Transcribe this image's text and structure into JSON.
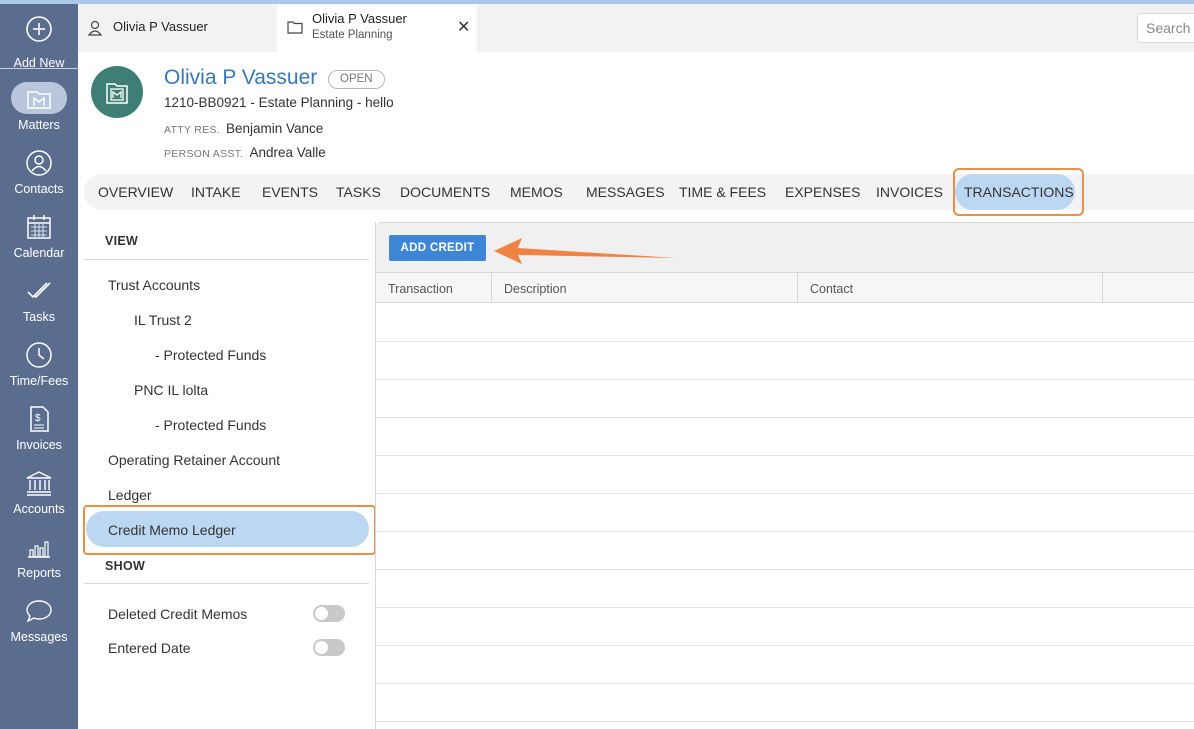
{
  "nav": {
    "add_new": "Add New",
    "items": [
      {
        "label": "Matters",
        "icon": "matters-icon"
      },
      {
        "label": "Contacts",
        "icon": "contacts-icon"
      },
      {
        "label": "Calendar",
        "icon": "calendar-icon"
      },
      {
        "label": "Tasks",
        "icon": "tasks-icon"
      },
      {
        "label": "Time/Fees",
        "icon": "clock-icon"
      },
      {
        "label": "Invoices",
        "icon": "invoice-icon"
      },
      {
        "label": "Accounts",
        "icon": "bank-icon"
      },
      {
        "label": "Reports",
        "icon": "reports-icon"
      },
      {
        "label": "Messages",
        "icon": "chat-icon"
      }
    ]
  },
  "tabs": {
    "tab1_title": "Olivia P Vassuer",
    "tab2_title": "Olivia P Vassuer",
    "tab2_subtitle": "Estate Planning",
    "close": "✕",
    "search_placeholder": "Search"
  },
  "matter": {
    "name": "Olivia P Vassuer",
    "status": "OPEN",
    "line": "1210-BB0921 - Estate Planning - hello",
    "atty_label": "ATTY RES.",
    "atty_value": "Benjamin Vance",
    "asst_label": "PERSON ASST.",
    "asst_value": "Andrea Valle"
  },
  "tabnav": [
    "OVERVIEW",
    "INTAKE",
    "EVENTS",
    "TASKS",
    "DOCUMENTS",
    "MEMOS",
    "MESSAGES",
    "TIME & FEES",
    "EXPENSES",
    "INVOICES",
    "TRANSACTIONS"
  ],
  "view": {
    "heading": "VIEW",
    "items": [
      "Trust Accounts",
      "IL Trust 2",
      "- Protected Funds",
      "PNC IL lolta",
      "- Protected Funds",
      "Operating Retainer Account",
      "Ledger",
      "Credit Memo Ledger"
    ]
  },
  "show": {
    "heading": "SHOW",
    "deleted": "Deleted Credit Memos",
    "entered": "Entered Date"
  },
  "main": {
    "add_credit": "ADD CREDIT",
    "columns": [
      "Transaction",
      "Description",
      "Contact"
    ]
  },
  "colors": {
    "accent": "#3d86d6",
    "nav_bg": "#5a6d8f",
    "highlight": "#e98f4c",
    "active": "#bcd7f2"
  }
}
